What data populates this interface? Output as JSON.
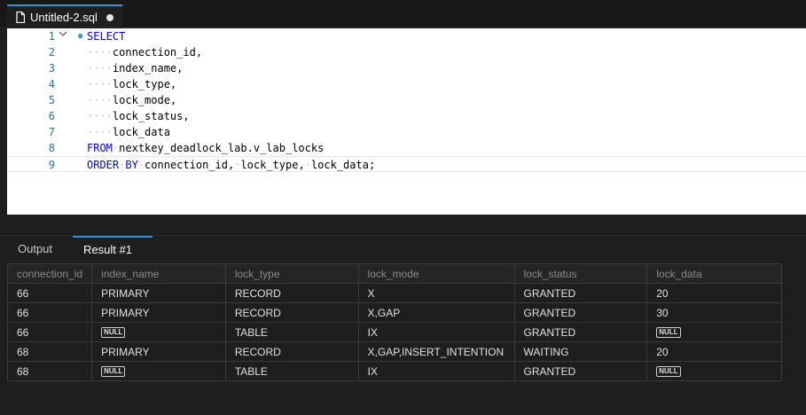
{
  "tab": {
    "title": "Untitled-2.sql",
    "dirty": true
  },
  "editor": {
    "lines": [
      {
        "num": "1",
        "tokens": [
          {
            "t": "SELECT",
            "k": "kw"
          }
        ]
      },
      {
        "num": "2",
        "tokens": [
          {
            "t": "····",
            "k": "ws"
          },
          {
            "t": "connection_id,",
            "k": ""
          }
        ]
      },
      {
        "num": "3",
        "tokens": [
          {
            "t": "····",
            "k": "ws"
          },
          {
            "t": "index_name,",
            "k": ""
          }
        ]
      },
      {
        "num": "4",
        "tokens": [
          {
            "t": "····",
            "k": "ws"
          },
          {
            "t": "lock_type,",
            "k": ""
          }
        ]
      },
      {
        "num": "5",
        "tokens": [
          {
            "t": "····",
            "k": "ws"
          },
          {
            "t": "lock_mode,",
            "k": ""
          }
        ]
      },
      {
        "num": "6",
        "tokens": [
          {
            "t": "····",
            "k": "ws"
          },
          {
            "t": "lock_status,",
            "k": ""
          }
        ]
      },
      {
        "num": "7",
        "tokens": [
          {
            "t": "····",
            "k": "ws"
          },
          {
            "t": "lock_data",
            "k": ""
          }
        ]
      },
      {
        "num": "8",
        "tokens": [
          {
            "t": "FROM",
            "k": "kw"
          },
          {
            "t": "·",
            "k": "ws"
          },
          {
            "t": "nextkey_deadlock_lab.v_lab_locks",
            "k": ""
          }
        ]
      },
      {
        "num": "9",
        "tokens": [
          {
            "t": "ORDER",
            "k": "kw"
          },
          {
            "t": "·",
            "k": "ws"
          },
          {
            "t": "BY",
            "k": "kw"
          },
          {
            "t": "·",
            "k": "ws"
          },
          {
            "t": "connection_id,",
            "k": ""
          },
          {
            "t": "·",
            "k": "ws"
          },
          {
            "t": "lock_type,",
            "k": ""
          },
          {
            "t": "·",
            "k": "ws"
          },
          {
            "t": "lock_data;",
            "k": ""
          }
        ]
      }
    ]
  },
  "panel": {
    "output_label": "Output",
    "result_label": "Result #1"
  },
  "grid": {
    "columns": [
      "connection_id",
      "index_name",
      "lock_type",
      "lock_mode",
      "lock_status",
      "lock_data"
    ],
    "null_label": "NULL",
    "rows": [
      [
        "66",
        "PRIMARY",
        "RECORD",
        "X",
        "GRANTED",
        "20"
      ],
      [
        "66",
        "PRIMARY",
        "RECORD",
        "X,GAP",
        "GRANTED",
        "30"
      ],
      [
        "66",
        null,
        "TABLE",
        "IX",
        "GRANTED",
        null
      ],
      [
        "68",
        "PRIMARY",
        "RECORD",
        "X,GAP,INSERT_INTENTION",
        "WAITING",
        "20"
      ],
      [
        "68",
        null,
        "TABLE",
        "IX",
        "GRANTED",
        null
      ]
    ]
  },
  "colors": {
    "accent": "#3a8fd6",
    "keyword": "#0000ff",
    "line_number": "#237893"
  }
}
